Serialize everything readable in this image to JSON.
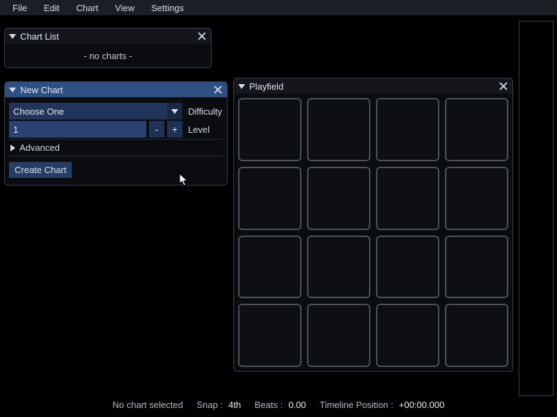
{
  "menu": {
    "items": [
      "File",
      "Edit",
      "Chart",
      "View",
      "Settings"
    ]
  },
  "chart_list": {
    "title": "Chart List",
    "empty_text": "- no charts -"
  },
  "new_chart": {
    "title": "New Chart",
    "difficulty_combo": "Choose One",
    "difficulty_label": "Difficulty",
    "level_value": "1",
    "minus": "-",
    "plus": "+",
    "level_label": "Level",
    "advanced": "Advanced",
    "create": "Create Chart"
  },
  "playfield": {
    "title": "Playfield",
    "grid": {
      "rows": 4,
      "cols": 4
    }
  },
  "status": {
    "no_chart": "No chart selected",
    "snap_label": "Snap :",
    "snap_value": "4th",
    "beats_label": "Beats :",
    "beats_value": "0.00",
    "tlpos_label": "Timeline Position :",
    "tlpos_value": "+00:00.000"
  }
}
